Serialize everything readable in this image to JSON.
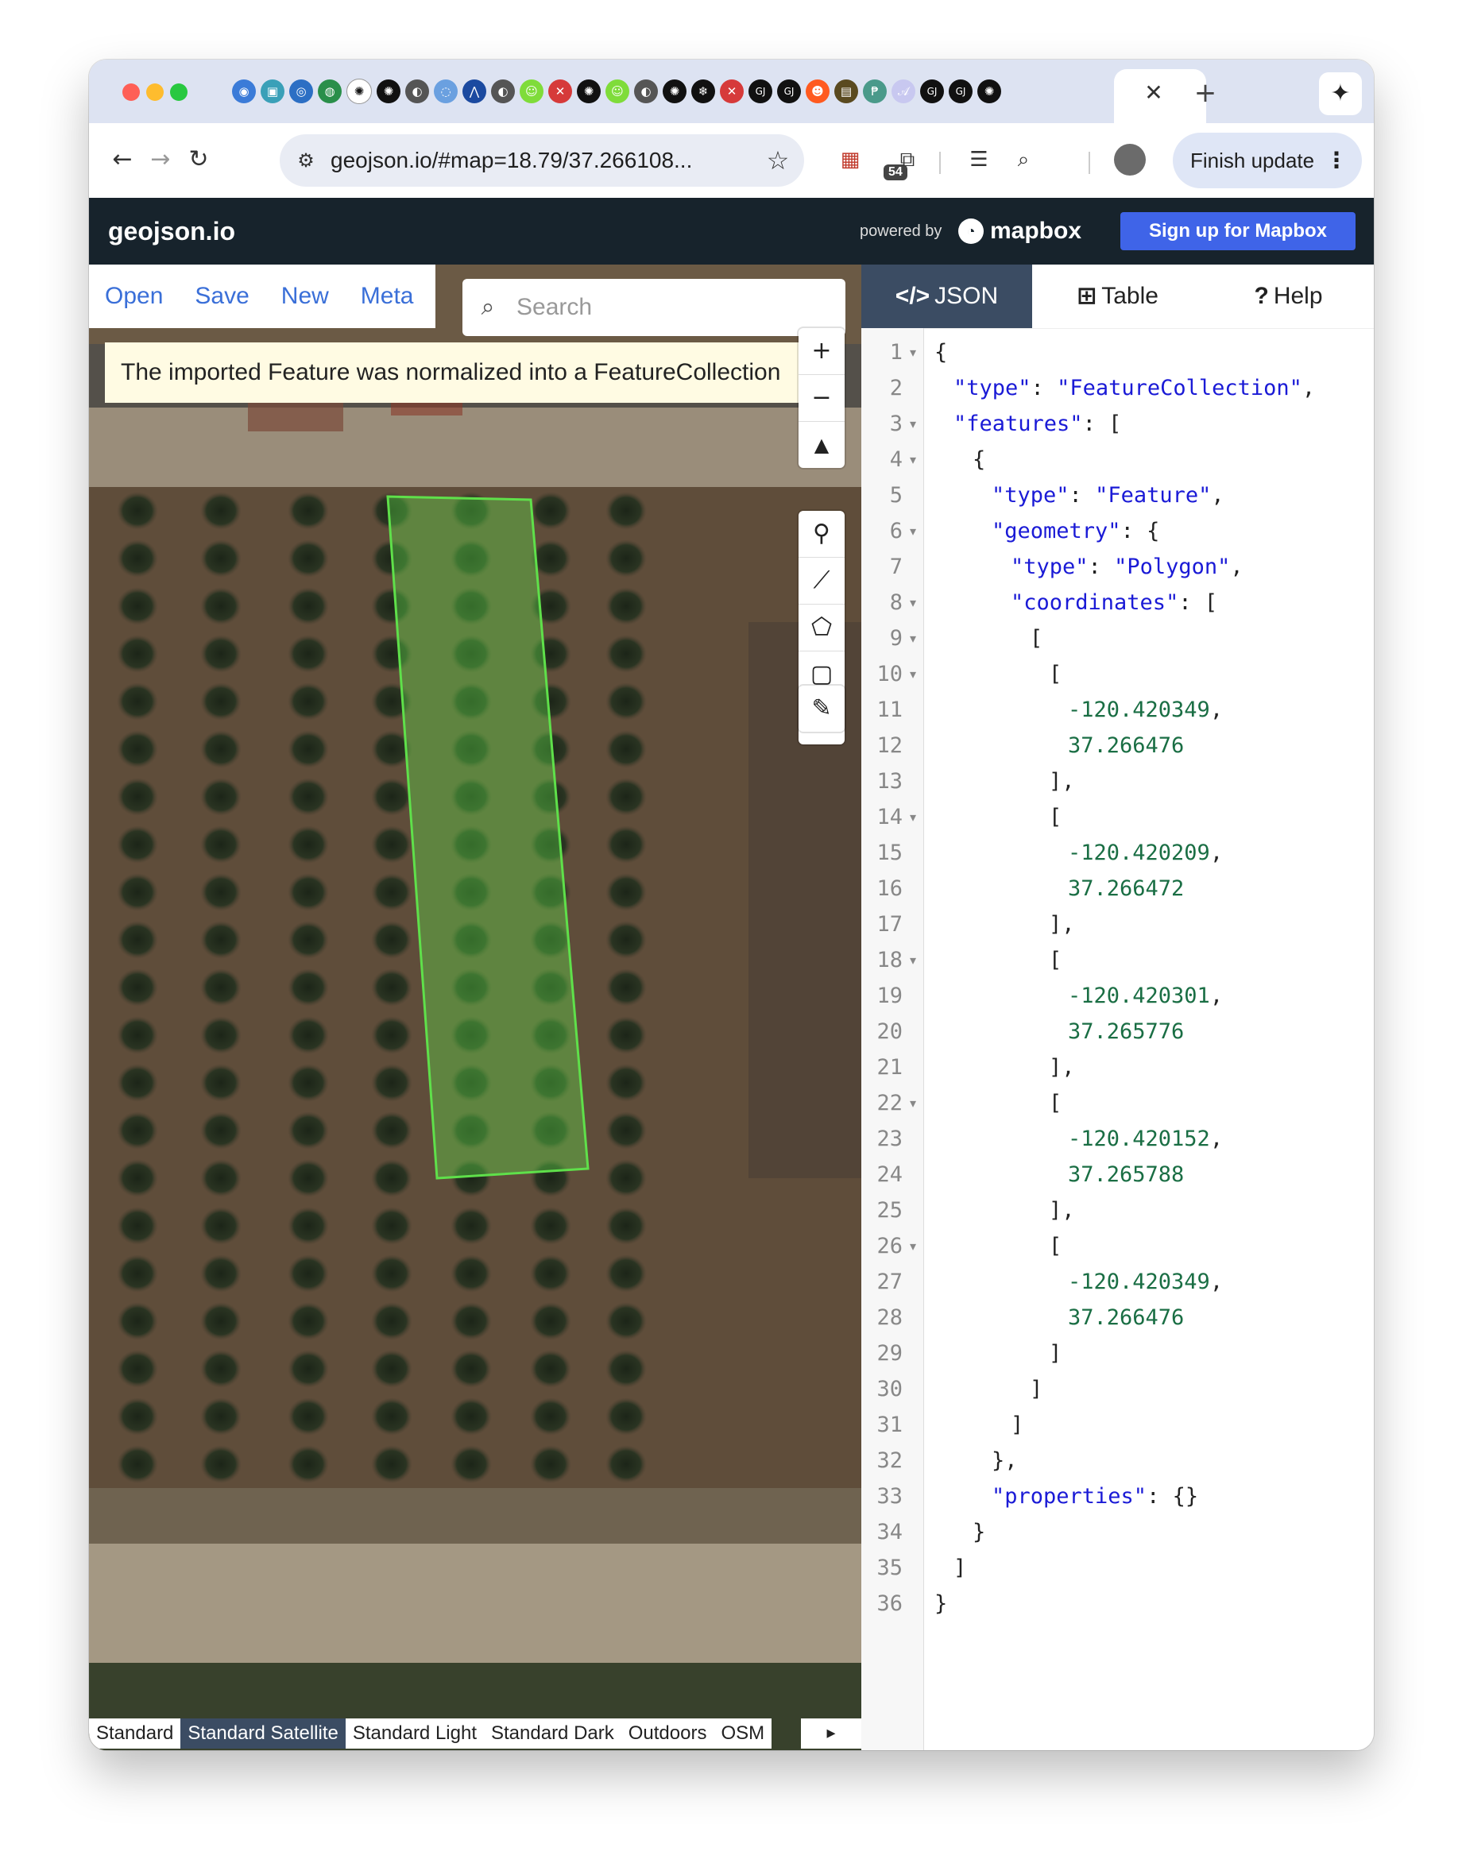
{
  "browser": {
    "url": "geojson.io/#map=18.79/37.266108...",
    "tab_close": "✕",
    "new_tab": "+",
    "extension_badge": "54",
    "finish_update_label": "Finish update",
    "menu_dots": "⋮",
    "favicons": [
      {
        "name": "favicon-1",
        "color": "#3b7bd8",
        "glyph": "◉"
      },
      {
        "name": "favicon-2",
        "color": "#3aa0b8",
        "glyph": "▣"
      },
      {
        "name": "favicon-3",
        "color": "#2c6fc4",
        "glyph": "◎"
      },
      {
        "name": "favicon-4",
        "color": "#2a8f4a",
        "glyph": "◍"
      },
      {
        "name": "favicon-5",
        "color": "#ffffff",
        "glyph": "✺"
      },
      {
        "name": "favicon-6",
        "color": "#111111",
        "glyph": "✺"
      },
      {
        "name": "favicon-7",
        "color": "#555555",
        "glyph": "◐"
      },
      {
        "name": "favicon-8",
        "color": "#6aa0e0",
        "glyph": "◌"
      },
      {
        "name": "favicon-9",
        "color": "#1b4aa0",
        "glyph": "⋀"
      },
      {
        "name": "favicon-10",
        "color": "#555555",
        "glyph": "◐"
      },
      {
        "name": "favicon-11",
        "color": "#7fdc3a",
        "glyph": "☺"
      },
      {
        "name": "favicon-12",
        "color": "#d63a3a",
        "glyph": "✕"
      },
      {
        "name": "favicon-13",
        "color": "#111111",
        "glyph": "✺"
      },
      {
        "name": "favicon-14",
        "color": "#7fdc3a",
        "glyph": "☺"
      },
      {
        "name": "favicon-15",
        "color": "#555555",
        "glyph": "◐"
      },
      {
        "name": "favicon-16",
        "color": "#111111",
        "glyph": "✺"
      },
      {
        "name": "favicon-17",
        "color": "#111111",
        "glyph": "❄"
      },
      {
        "name": "favicon-18",
        "color": "#d63a3a",
        "glyph": "✕"
      },
      {
        "name": "favicon-19",
        "color": "#111111",
        "glyph": "GJ"
      },
      {
        "name": "favicon-20",
        "color": "#111111",
        "glyph": "GJ"
      },
      {
        "name": "favicon-21",
        "color": "#ff5a1f",
        "glyph": "☻"
      },
      {
        "name": "favicon-22",
        "color": "#5a4a20",
        "glyph": "▤"
      },
      {
        "name": "favicon-23",
        "color": "#4a9a8a",
        "glyph": "₱"
      },
      {
        "name": "favicon-24",
        "color": "#c8c8f0",
        "glyph": "𝒜"
      },
      {
        "name": "favicon-25",
        "color": "#111111",
        "glyph": "GJ"
      },
      {
        "name": "favicon-26",
        "color": "#111111",
        "glyph": "GJ"
      },
      {
        "name": "favicon-27",
        "color": "#111111",
        "glyph": "✺"
      }
    ]
  },
  "app": {
    "brand": "geojson.io",
    "powered_by": "powered by",
    "mapbox_label": "mapbox",
    "signup_label": "Sign up for Mapbox",
    "menu": [
      "Open",
      "Save",
      "New",
      "Meta"
    ],
    "search_placeholder": "Search",
    "notice": "The imported Feature was normalized into a FeatureCollection",
    "map_styles": [
      "Standard",
      "Standard Satellite",
      "Standard Light",
      "Standard Dark",
      "Outdoors",
      "OSM"
    ],
    "active_style": "Standard Satellite",
    "map_logo": "mapbox",
    "info_label": "i",
    "polygon_color": "#5fe04a"
  },
  "panel": {
    "tabs": [
      {
        "icon": "</>",
        "label": "JSON",
        "active": true
      },
      {
        "icon": "⊞",
        "label": "Table",
        "active": false
      },
      {
        "icon": "?",
        "label": "Help",
        "active": false
      }
    ],
    "code_lines": [
      {
        "n": "1",
        "fold": true,
        "indent": 0,
        "parts": [
          [
            "p",
            "{"
          ]
        ]
      },
      {
        "n": "2",
        "fold": false,
        "indent": 1,
        "parts": [
          [
            "k",
            "\"type\""
          ],
          [
            "p",
            ": "
          ],
          [
            "s",
            "\"FeatureCollection\""
          ],
          [
            "p",
            ","
          ]
        ]
      },
      {
        "n": "3",
        "fold": true,
        "indent": 1,
        "parts": [
          [
            "k",
            "\"features\""
          ],
          [
            "p",
            ": ["
          ]
        ]
      },
      {
        "n": "4",
        "fold": true,
        "indent": 2,
        "parts": [
          [
            "p",
            "{"
          ]
        ]
      },
      {
        "n": "5",
        "fold": false,
        "indent": 3,
        "parts": [
          [
            "k",
            "\"type\""
          ],
          [
            "p",
            ": "
          ],
          [
            "s",
            "\"Feature\""
          ],
          [
            "p",
            ","
          ]
        ]
      },
      {
        "n": "6",
        "fold": true,
        "indent": 3,
        "parts": [
          [
            "k",
            "\"geometry\""
          ],
          [
            "p",
            ": {"
          ]
        ]
      },
      {
        "n": "7",
        "fold": false,
        "indent": 4,
        "parts": [
          [
            "k",
            "\"type\""
          ],
          [
            "p",
            ": "
          ],
          [
            "s",
            "\"Polygon\""
          ],
          [
            "p",
            ","
          ]
        ]
      },
      {
        "n": "8",
        "fold": true,
        "indent": 4,
        "parts": [
          [
            "k",
            "\"coordinates\""
          ],
          [
            "p",
            ": ["
          ]
        ]
      },
      {
        "n": "9",
        "fold": true,
        "indent": 5,
        "parts": [
          [
            "p",
            "["
          ]
        ]
      },
      {
        "n": "10",
        "fold": true,
        "indent": 6,
        "parts": [
          [
            "p",
            "["
          ]
        ]
      },
      {
        "n": "11",
        "fold": false,
        "indent": 7,
        "parts": [
          [
            "n",
            "-120.420349"
          ],
          [
            "p",
            ","
          ]
        ]
      },
      {
        "n": "12",
        "fold": false,
        "indent": 7,
        "parts": [
          [
            "n",
            "37.266476"
          ]
        ]
      },
      {
        "n": "13",
        "fold": false,
        "indent": 6,
        "parts": [
          [
            "p",
            "],"
          ]
        ]
      },
      {
        "n": "14",
        "fold": true,
        "indent": 6,
        "parts": [
          [
            "p",
            "["
          ]
        ]
      },
      {
        "n": "15",
        "fold": false,
        "indent": 7,
        "parts": [
          [
            "n",
            "-120.420209"
          ],
          [
            "p",
            ","
          ]
        ]
      },
      {
        "n": "16",
        "fold": false,
        "indent": 7,
        "parts": [
          [
            "n",
            "37.266472"
          ]
        ]
      },
      {
        "n": "17",
        "fold": false,
        "indent": 6,
        "parts": [
          [
            "p",
            "],"
          ]
        ]
      },
      {
        "n": "18",
        "fold": true,
        "indent": 6,
        "parts": [
          [
            "p",
            "["
          ]
        ]
      },
      {
        "n": "19",
        "fold": false,
        "indent": 7,
        "parts": [
          [
            "n",
            "-120.420301"
          ],
          [
            "p",
            ","
          ]
        ]
      },
      {
        "n": "20",
        "fold": false,
        "indent": 7,
        "parts": [
          [
            "n",
            "37.265776"
          ]
        ]
      },
      {
        "n": "21",
        "fold": false,
        "indent": 6,
        "parts": [
          [
            "p",
            "],"
          ]
        ]
      },
      {
        "n": "22",
        "fold": true,
        "indent": 6,
        "parts": [
          [
            "p",
            "["
          ]
        ]
      },
      {
        "n": "23",
        "fold": false,
        "indent": 7,
        "parts": [
          [
            "n",
            "-120.420152"
          ],
          [
            "p",
            ","
          ]
        ]
      },
      {
        "n": "24",
        "fold": false,
        "indent": 7,
        "parts": [
          [
            "n",
            "37.265788"
          ]
        ]
      },
      {
        "n": "25",
        "fold": false,
        "indent": 6,
        "parts": [
          [
            "p",
            "],"
          ]
        ]
      },
      {
        "n": "26",
        "fold": true,
        "indent": 6,
        "parts": [
          [
            "p",
            "["
          ]
        ]
      },
      {
        "n": "27",
        "fold": false,
        "indent": 7,
        "parts": [
          [
            "n",
            "-120.420349"
          ],
          [
            "p",
            ","
          ]
        ]
      },
      {
        "n": "28",
        "fold": false,
        "indent": 7,
        "parts": [
          [
            "n",
            "37.266476"
          ]
        ]
      },
      {
        "n": "29",
        "fold": false,
        "indent": 6,
        "parts": [
          [
            "p",
            "]"
          ]
        ]
      },
      {
        "n": "30",
        "fold": false,
        "indent": 5,
        "parts": [
          [
            "p",
            "]"
          ]
        ]
      },
      {
        "n": "31",
        "fold": false,
        "indent": 4,
        "parts": [
          [
            "p",
            "]"
          ]
        ]
      },
      {
        "n": "32",
        "fold": false,
        "indent": 3,
        "parts": [
          [
            "p",
            "},"
          ]
        ]
      },
      {
        "n": "33",
        "fold": false,
        "indent": 3,
        "parts": [
          [
            "k",
            "\"properties\""
          ],
          [
            "p",
            ": {}"
          ]
        ]
      },
      {
        "n": "34",
        "fold": false,
        "indent": 2,
        "parts": [
          [
            "p",
            "}"
          ]
        ]
      },
      {
        "n": "35",
        "fold": false,
        "indent": 1,
        "parts": [
          [
            "p",
            "]"
          ]
        ]
      },
      {
        "n": "36",
        "fold": false,
        "indent": 0,
        "parts": [
          [
            "p",
            "}"
          ]
        ]
      }
    ]
  }
}
